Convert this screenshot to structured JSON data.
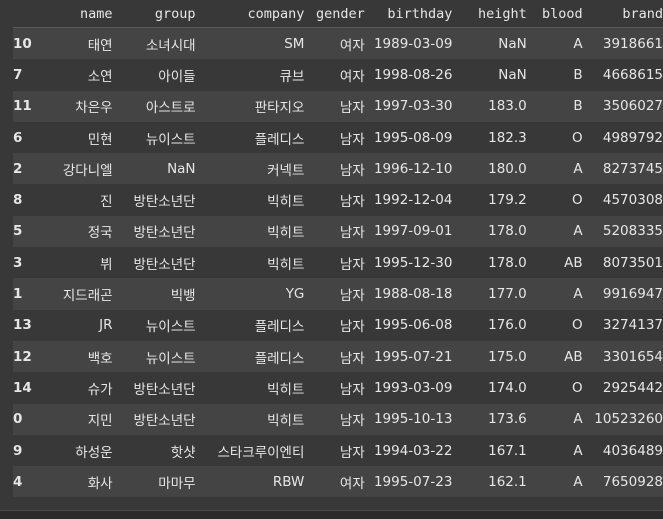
{
  "columns": [
    "",
    "name",
    "group",
    "company",
    "gender",
    "birthday",
    "height",
    "blood",
    "brand"
  ],
  "rows": [
    {
      "idx": "10",
      "name": "태연",
      "group": "소녀시대",
      "company": "SM",
      "gender": "여자",
      "birthday": "1989-03-09",
      "height": "NaN",
      "blood": "A",
      "brand": "3918661"
    },
    {
      "idx": "7",
      "name": "소연",
      "group": "아이들",
      "company": "큐브",
      "gender": "여자",
      "birthday": "1998-08-26",
      "height": "NaN",
      "blood": "B",
      "brand": "4668615"
    },
    {
      "idx": "11",
      "name": "차은우",
      "group": "아스트로",
      "company": "판타지오",
      "gender": "남자",
      "birthday": "1997-03-30",
      "height": "183.0",
      "blood": "B",
      "brand": "3506027"
    },
    {
      "idx": "6",
      "name": "민현",
      "group": "뉴이스트",
      "company": "플레디스",
      "gender": "남자",
      "birthday": "1995-08-09",
      "height": "182.3",
      "blood": "O",
      "brand": "4989792"
    },
    {
      "idx": "2",
      "name": "강다니엘",
      "group": "NaN",
      "company": "커넥트",
      "gender": "남자",
      "birthday": "1996-12-10",
      "height": "180.0",
      "blood": "A",
      "brand": "8273745"
    },
    {
      "idx": "8",
      "name": "진",
      "group": "방탄소년단",
      "company": "빅히트",
      "gender": "남자",
      "birthday": "1992-12-04",
      "height": "179.2",
      "blood": "O",
      "brand": "4570308"
    },
    {
      "idx": "5",
      "name": "정국",
      "group": "방탄소년단",
      "company": "빅히트",
      "gender": "남자",
      "birthday": "1997-09-01",
      "height": "178.0",
      "blood": "A",
      "brand": "5208335"
    },
    {
      "idx": "3",
      "name": "뷔",
      "group": "방탄소년단",
      "company": "빅히트",
      "gender": "남자",
      "birthday": "1995-12-30",
      "height": "178.0",
      "blood": "AB",
      "brand": "8073501"
    },
    {
      "idx": "1",
      "name": "지드래곤",
      "group": "빅뱅",
      "company": "YG",
      "gender": "남자",
      "birthday": "1988-08-18",
      "height": "177.0",
      "blood": "A",
      "brand": "9916947"
    },
    {
      "idx": "13",
      "name": "JR",
      "group": "뉴이스트",
      "company": "플레디스",
      "gender": "남자",
      "birthday": "1995-06-08",
      "height": "176.0",
      "blood": "O",
      "brand": "3274137"
    },
    {
      "idx": "12",
      "name": "백호",
      "group": "뉴이스트",
      "company": "플레디스",
      "gender": "남자",
      "birthday": "1995-07-21",
      "height": "175.0",
      "blood": "AB",
      "brand": "3301654"
    },
    {
      "idx": "14",
      "name": "슈가",
      "group": "방탄소년단",
      "company": "빅히트",
      "gender": "남자",
      "birthday": "1993-03-09",
      "height": "174.0",
      "blood": "O",
      "brand": "2925442"
    },
    {
      "idx": "0",
      "name": "지민",
      "group": "방탄소년단",
      "company": "빅히트",
      "gender": "남자",
      "birthday": "1995-10-13",
      "height": "173.6",
      "blood": "A",
      "brand": "10523260"
    },
    {
      "idx": "9",
      "name": "하성운",
      "group": "핫샷",
      "company": "스타크루이엔티",
      "gender": "남자",
      "birthday": "1994-03-22",
      "height": "167.1",
      "blood": "A",
      "brand": "4036489"
    },
    {
      "idx": "4",
      "name": "화사",
      "group": "마마무",
      "company": "RBW",
      "gender": "여자",
      "birthday": "1995-07-23",
      "height": "162.1",
      "blood": "A",
      "brand": "7650928"
    }
  ]
}
